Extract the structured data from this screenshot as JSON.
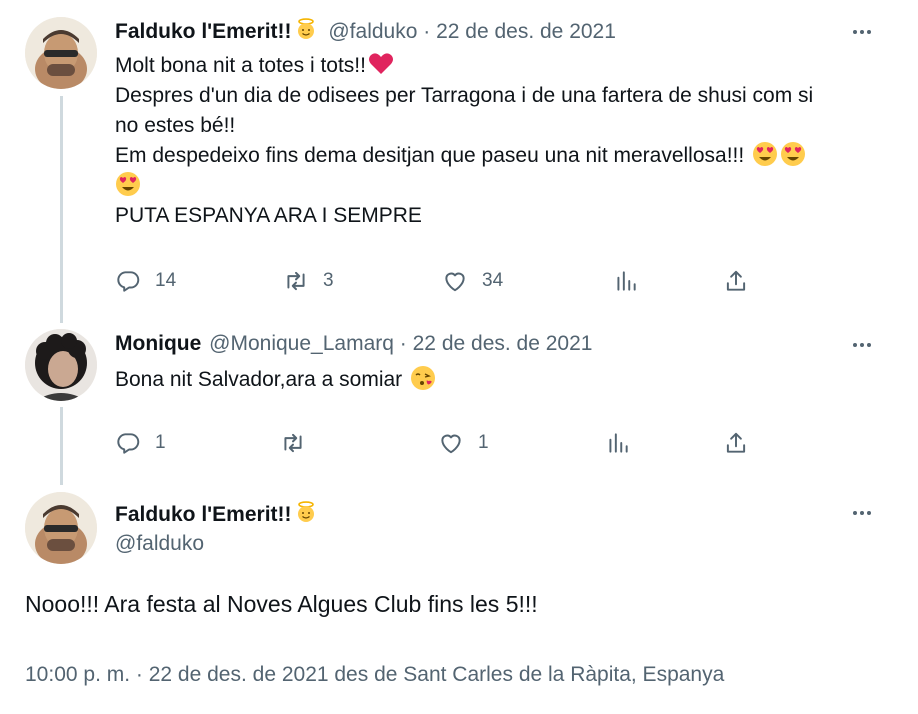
{
  "tweets": [
    {
      "name": "Falduko l'Emerit!!",
      "handle": "@falduko",
      "separator": "·",
      "date": "22 de des. de 2021",
      "lines": [
        "Molt bona nit a totes i tots!!",
        "Despres d'un dia de odisees per Tarragona i de una fartera de shusi com si",
        "no estes bé!!",
        "Em despedeixo fins dema desitjan que paseu una nit meravellosa!!!",
        "PUTA ESPANYA ARA I SEMPRE"
      ],
      "replies": "14",
      "retweets": "3",
      "likes": "34"
    },
    {
      "name": "Monique",
      "handle": "@Monique_Lamarq",
      "separator": "·",
      "date": "22 de des. de 2021",
      "text": "Bona nit Salvador,ara a somiar",
      "replies": "1",
      "retweets": "",
      "likes": "1"
    }
  ],
  "main_tweet": {
    "name": "Falduko l'Emerit!!",
    "handle": "@falduko",
    "text": "Nooo!!! Ara festa al Noves Algues Club fins les 5!!!",
    "meta": "10:00 p. m. · 22 de des. de 2021 des de Sant Carles de la Ràpita, Espanya"
  },
  "icons": {
    "more": "more-horizontal-icon",
    "reply": "reply-icon",
    "retweet": "retweet-icon",
    "like": "heart-icon",
    "views": "analytics-icon",
    "share": "share-icon",
    "halo": "angel-emoji-icon",
    "heart_emoji": "red-heart-emoji-icon",
    "heart_eyes": "heart-eyes-emoji-icon",
    "kiss": "kiss-emoji-icon"
  },
  "colors": {
    "text": "#0f1419",
    "muted": "#536471",
    "thread_line": "#cfd9de",
    "heart": "#e0245e"
  }
}
